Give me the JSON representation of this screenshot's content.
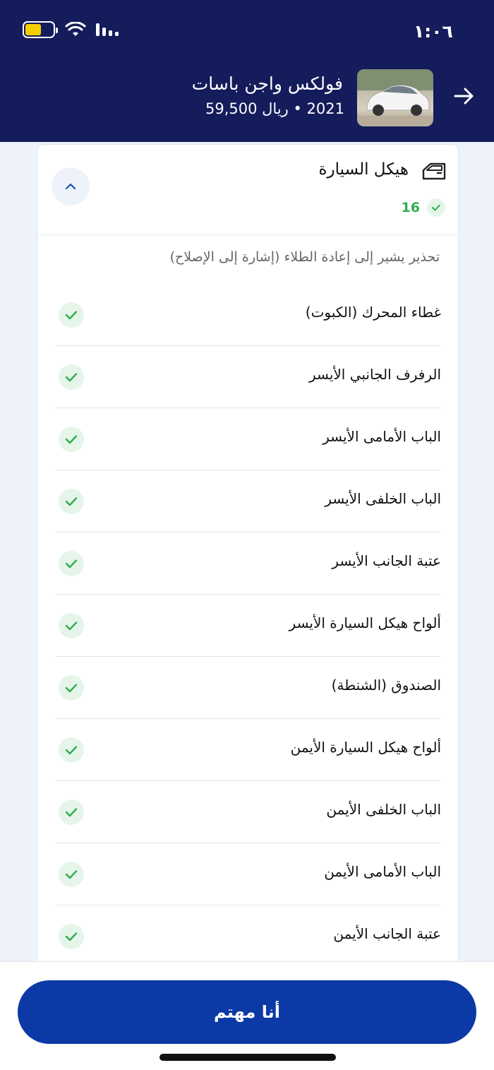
{
  "status_bar": {
    "time": "١:٠٦",
    "battery_color": "#f5d000"
  },
  "header": {
    "title": "فولكس واجن باسات",
    "subtitle": "2021 • ريال 59,500",
    "background": "#141c5b",
    "back_icon": "arrow-right-icon"
  },
  "section": {
    "title": "هيكل السيارة",
    "icon": "car-door-icon",
    "count": "16",
    "warning_note": "تحذير يشير إلى إعادة الطلاء (إشارة إلى الإصلاح)",
    "items": [
      {
        "label": "غطاء المحرك (الكبوت)"
      },
      {
        "label": "الرفرف الجانبي الأيسر"
      },
      {
        "label": "الباب الأمامى الأيسر"
      },
      {
        "label": "الباب الخلفى الأيسر"
      },
      {
        "label": "عتبة الجانب الأيسر"
      },
      {
        "label": "ألواح هيكل السيارة الأيسر"
      },
      {
        "label": "الصندوق (الشنطة)"
      },
      {
        "label": "ألواح هيكل السيارة الأيمن"
      },
      {
        "label": "الباب الخلفى الأيمن"
      },
      {
        "label": "الباب الأمامى الأيمن"
      },
      {
        "label": "عتبة الجانب الأيمن"
      }
    ]
  },
  "footer": {
    "cta_label": "أنا مهتم",
    "cta_color": "#0b3aa6"
  }
}
